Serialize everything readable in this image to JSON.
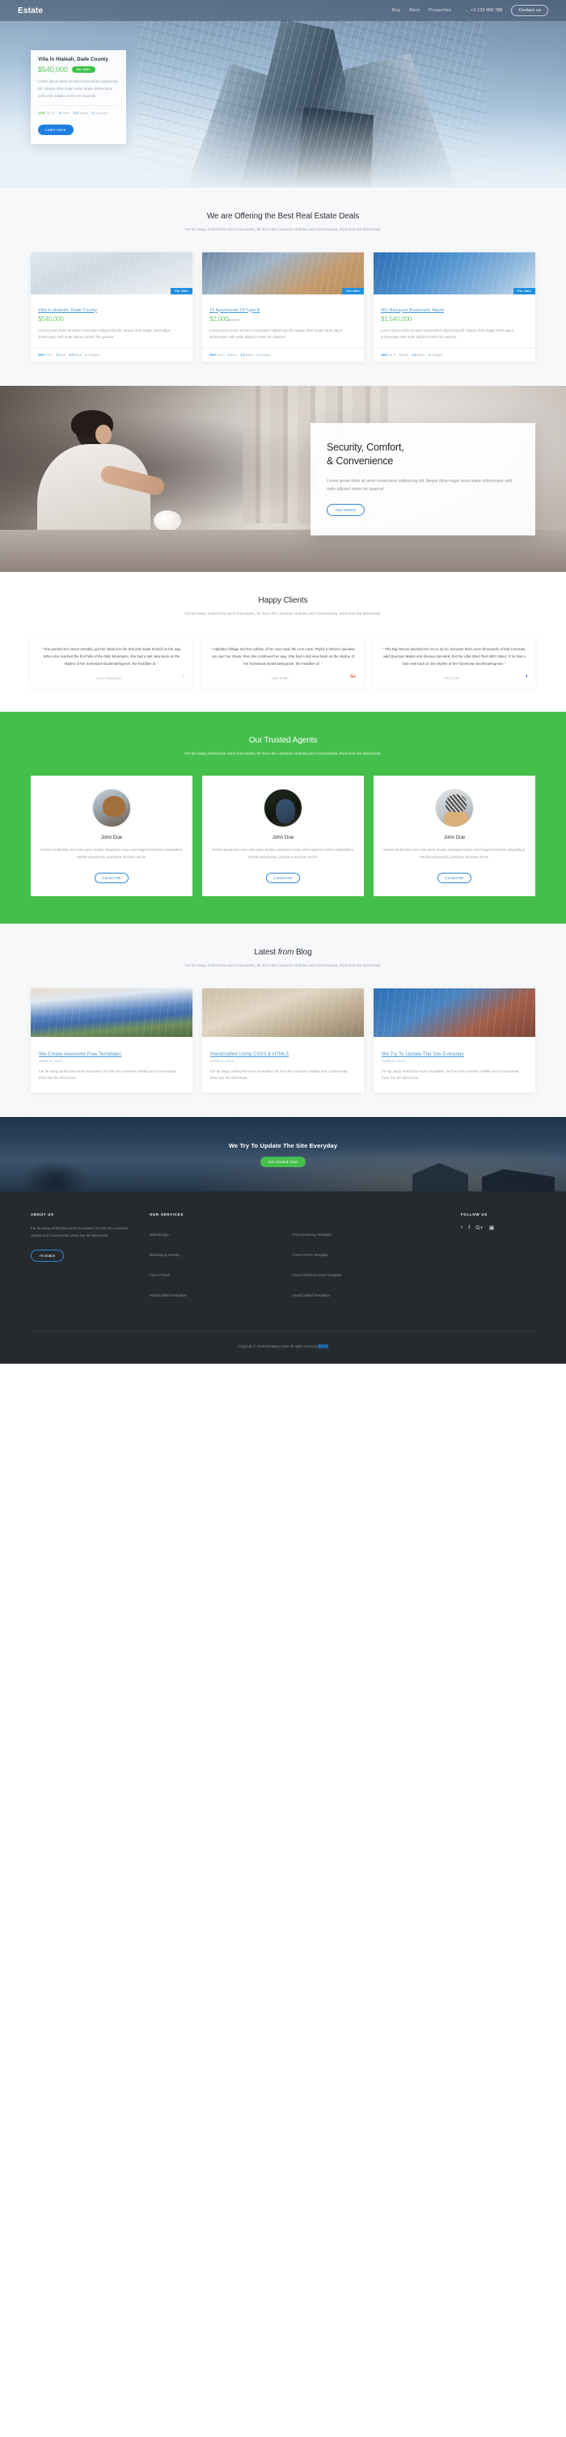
{
  "header": {
    "brand": "Estate",
    "nav": [
      {
        "label": "Buy"
      },
      {
        "label": "Rent"
      },
      {
        "label": "Properties"
      }
    ],
    "phone": "+1 123 456 789",
    "phone_icon": "phone-icon",
    "contact_button": "Contact us"
  },
  "hero_card": {
    "title": "Villa In Hialeah, Dade County",
    "price": "$540,000",
    "badge": "For Sale",
    "description": "Lorem ipsum dolor sit amet consectetur adipisicing elit. Neque dicta magni amet atque doloremque velit unde adipisci omnis hic quaerat.",
    "meta": {
      "sqft_value": "3500",
      "sqft_label": "Sq Ft",
      "beds_value": "3",
      "beds_label": "Beds",
      "baths_value": "3.5",
      "baths_label": "Baths",
      "garages_value": "2",
      "garages_label": "Garages"
    },
    "cta": "Learn more"
  },
  "offers": {
    "title": "We are Offering the Best Real Estate Deals",
    "subtitle": "Far far away, behind the word mountains, far from the countries Vokalia and Consonantia, there live the blind texts.",
    "properties": [
      {
        "name": "Villa In Hialeah, Dade County",
        "price": "$540,000",
        "price_unit": "",
        "badge": "For Sale",
        "description": "Lorem ipsum dolor sit amet consectetur adipisicing elit. Neque dicta magni amet atque doloremque velit unde adipisci omnis hic quaerat.",
        "sqft_value": "3500",
        "sqft_label": "Sq Ft",
        "beds_value": "3",
        "beds_label": "Beds",
        "baths_value": "3.5",
        "baths_label": "Baths",
        "garages_value": "2",
        "garages_label": "Garages"
      },
      {
        "name": "15 Apartments Of Type B",
        "price": "$2,000",
        "price_unit": "MONTH",
        "badge": "For Sale",
        "description": "Lorem ipsum dolor sit amet consectetur adipisicing elit. Neque dicta magni amet atque doloremque velit unde adipisci omnis hic quaerat.",
        "sqft_value": "3500",
        "sqft_label": "Sq Ft",
        "beds_value": "3",
        "beds_label": "Beds",
        "baths_value": "3.5",
        "baths_label": "Baths",
        "garages_value": "2",
        "garages_label": "Garages"
      },
      {
        "name": "401 Biscayne Boulevard, Miami",
        "price": "$1,540,000",
        "price_unit": "",
        "badge": "For Sale",
        "description": "Lorem ipsum dolor sit amet consectetur adipisicing elit. Neque dicta magni amet atque doloremque velit unde adipisci omnis hic quaerat.",
        "sqft_value": "3500",
        "sqft_label": "Sq Ft",
        "beds_value": "3",
        "beds_label": "Beds",
        "baths_value": "3.5",
        "baths_label": "Baths",
        "garages_value": "2",
        "garages_label": "Garages"
      }
    ]
  },
  "feature": {
    "heading_line1": "Security, Comfort,",
    "heading_line2": "& Convenience",
    "paragraph": "Lorem ipsum dolor sit amet consectetur adipisicing elit. Neque dicta magni amet atque doloremque velit unde adipisci omnis hic quaerat.",
    "cta": "Get started"
  },
  "clients": {
    "title": "Happy Clients",
    "subtitle": "Far far away, behind the word mountains, far from the countries Vokalia and Consonantia, there live the blind texts.",
    "testimonials": [
      {
        "quote": "\" She packed her seven versalia, put her initial into the belt and made herself on the way. When she reached the first hills of the Italic Mountains, she had a last view back on the skyline of her hometown Bookmarksgrove, the headline of. \"",
        "name": "Jason Davidson",
        "icon": "twitter-icon",
        "icon_glyph": "ᵛ",
        "icon_class": "ico-tw"
      },
      {
        "quote": "\" Alphabet Village and the subline of her own road, the Line Lane. Pityful a rethoric question ran over her cheek, then she continued her way. She had a last view back on the skyline of her hometown Bookmarksgrove, the headline of. \"",
        "name": "Kyle Smith",
        "icon": "google-plus-icon",
        "icon_glyph": "G+",
        "icon_class": "ico-gp"
      },
      {
        "quote": "\" The Big Oxmox advised her not to do so, because there were thousands of bad Commas, wild Question Marks and devious Semikoli, but the Little Blind Text didn't listen. S he had a last view back on the skyline of her hometown Bookmarksgrove. \"",
        "name": "Rick Cook",
        "icon": "facebook-icon",
        "icon_glyph": "f",
        "icon_class": "ico-fb"
      }
    ]
  },
  "agents": {
    "title": "Our Trusted Agents",
    "subtitle": "Far far away, behind the word mountains, far from the countries Vokalia and Consonantia, there live the blind texts.",
    "accent_color": "#45bf4c",
    "people": [
      {
        "name": "John Doe",
        "bio": "Veniam laudantium rem odio quod, beatae voluptates natus animi fugiat provident voluptatibus. Debitis assumenda, possimus ducimus omnis.",
        "cta": "Contact Me",
        "avatar": "agent-avatar-1"
      },
      {
        "name": "John Doe",
        "bio": "Veniam laudantium rem odio quod, beatae voluptates natus animi fugiat provident voluptatibus. Debitis assumenda, possimus ducimus omnis.",
        "cta": "Contact Me",
        "avatar": "agent-avatar-2"
      },
      {
        "name": "John Doe",
        "bio": "Veniam laudantium rem odio quod, beatae voluptates natus animi fugiat provident voluptatibus. Debitis assumenda, possimus ducimus omnis.",
        "cta": "Contact Me",
        "avatar": "agent-avatar-3"
      }
    ]
  },
  "blog": {
    "title_pre": "Latest ",
    "title_em": "from",
    "title_post": " Blog",
    "subtitle": "Far far away, behind the word mountains, far from the countries Vokalia and Consonantia, there live the blind texts.",
    "posts": [
      {
        "title": "We Create Awesome Free Templates",
        "date": "JUNE 8, 2016",
        "excerpt": "Far far away, behind the word mountains, far from the countries Vokalia and Consonantia, there live the blind texts."
      },
      {
        "title": "Handcrafted Using CSS3 & HTML5",
        "date": "JUNE 8, 2016",
        "excerpt": "Far far away, behind the word mountains, far from the countries Vokalia and Consonantia, there live the blind texts."
      },
      {
        "title": "We Try To Update The Site Everyday",
        "date": "JUNE 8, 2016",
        "excerpt": "Far far away, behind the word mountains, far from the countries Vokalia and Consonantia, there live the blind texts."
      }
    ]
  },
  "cta_banner": {
    "heading": "We Try To Update The Site Everyday",
    "button": "Get started now!"
  },
  "footer": {
    "about_heading": "ABOUT US",
    "about_text": "Far far away, behind the word mountains, far from the countries Vokalia and Consonantia, there live the blind texts.",
    "about_button": "I'm button",
    "services_heading": "OUR SERVICES",
    "services_col1": [
      {
        "label": "Web Design"
      },
      {
        "label": "Branding & Identity"
      },
      {
        "label": "Free HTML5"
      },
      {
        "label": "HandCrafted Templates"
      }
    ],
    "services_col2": [
      {
        "label": "Free Bootstrap Template"
      },
      {
        "label": "Free HTML5 Template"
      },
      {
        "label": "Free HTML5 & CSS3 Template"
      },
      {
        "label": "HandCrafted Templates"
      }
    ],
    "follow_heading": "FOLLOW US",
    "socials": [
      {
        "icon": "twitter-icon",
        "glyph": "ᵛ"
      },
      {
        "icon": "facebook-icon",
        "glyph": "f"
      },
      {
        "icon": "google-plus-icon",
        "glyph": "G+"
      },
      {
        "icon": "instagram-icon",
        "glyph": "▣"
      }
    ],
    "copyright": "Copyright © 2016.Company name All rights reserved.",
    "copyright_link": "模板铺"
  }
}
